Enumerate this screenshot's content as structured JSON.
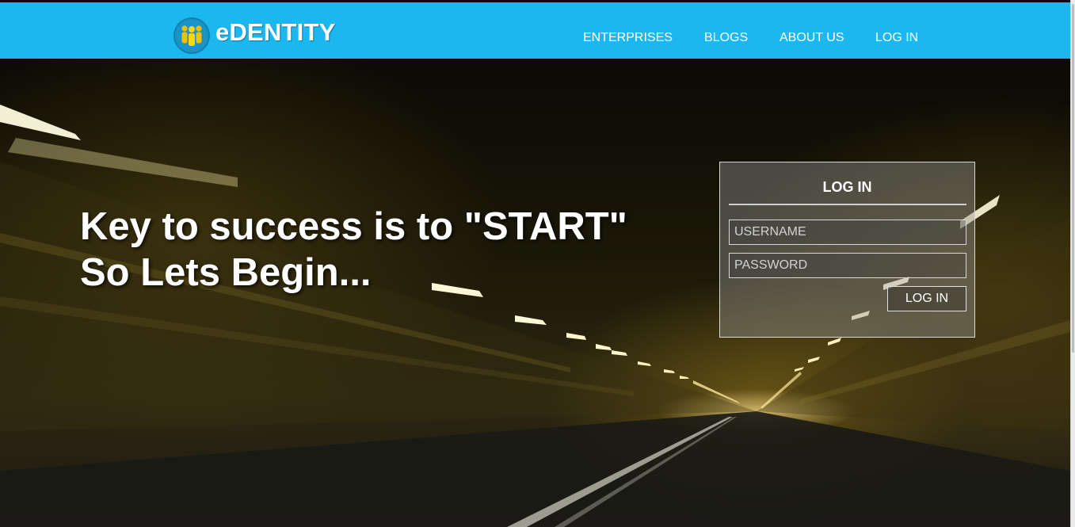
{
  "header": {
    "brand": "eDENTITY",
    "nav": [
      "ENTERPRISES",
      "BLOGS",
      "ABOUT US",
      "LOG IN"
    ],
    "background_color": "#1bb8f0"
  },
  "hero": {
    "tagline_line1": "Key to success is to \"START\"",
    "tagline_line2": "So Lets Begin..."
  },
  "login": {
    "title": "LOG IN",
    "username_placeholder": "USERNAME",
    "password_placeholder": "PASSWORD",
    "button_label": "LOG IN"
  }
}
